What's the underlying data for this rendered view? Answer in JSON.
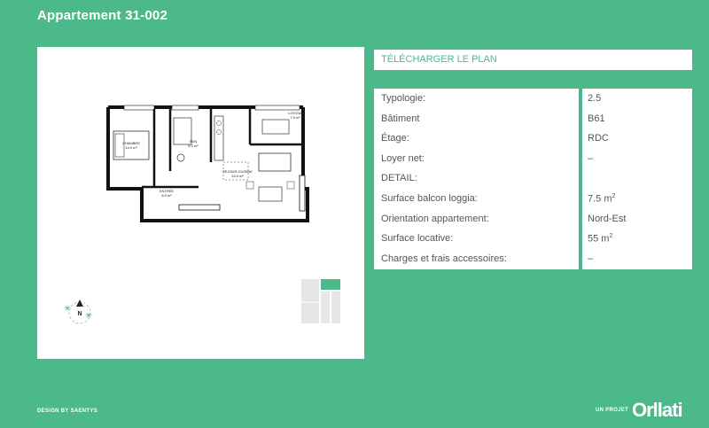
{
  "header": {
    "title": "Appartement 31-002"
  },
  "plan": {
    "rooms": {
      "chambre": "CHAMBRE",
      "chambre_area": "14.0 m²",
      "soin": "SDN",
      "soin_area": "6.0 m²",
      "loggia": "LOGGIA",
      "loggia_area": "7.5 m²",
      "sejour": "SÉJOUR-CUISINE",
      "sejour_area": "24.0 m²",
      "entree": "ENTRÉE",
      "entree_area": "8.5 m²"
    },
    "compass_label": "N"
  },
  "actions": {
    "download_label": "TÉLÉCHARGER LE PLAN"
  },
  "details": [
    {
      "label": "Typologie:",
      "value": "2.5",
      "unit": ""
    },
    {
      "label": "Bâtiment",
      "value": "B61",
      "unit": ""
    },
    {
      "label": "Étage:",
      "value": "RDC",
      "unit": ""
    },
    {
      "label": "Loyer net:",
      "value": "–",
      "unit": ""
    },
    {
      "label": "DETAIL:",
      "value": "",
      "unit": ""
    },
    {
      "label": "Surface balcon loggia:",
      "value": "7.5 m",
      "unit": "2"
    },
    {
      "label": "Orientation appartement:",
      "value": "Nord-Est",
      "unit": ""
    },
    {
      "label": "Surface locative:",
      "value": "55 m",
      "unit": "2"
    },
    {
      "label": "Charges et frais accessoires:",
      "value": "–",
      "unit": ""
    }
  ],
  "footer": {
    "design_credit": "DESIGN BY SAENTYS",
    "project_label": "UN PROJET",
    "brand": "Orllati"
  },
  "colors": {
    "accent": "#4bb98a",
    "panel": "#ffffff",
    "text": "#555555"
  }
}
